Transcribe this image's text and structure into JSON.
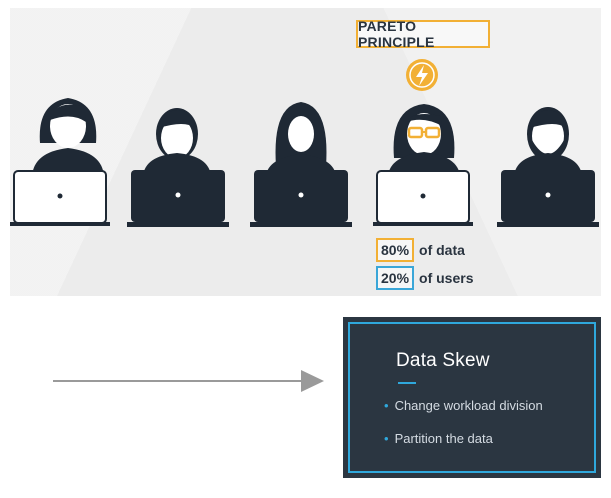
{
  "illustration": {
    "principle_label": "PARETO PRINCIPLE",
    "stats": [
      {
        "pct": "80%",
        "text": "of data",
        "color": "#f2b035"
      },
      {
        "pct": "20%",
        "text": "of users",
        "color": "#3aa6d8"
      }
    ],
    "icons": [
      "user-woman-icon",
      "user-man-icon",
      "user-hijab-icon",
      "user-woman-glasses-icon",
      "user-bearded-man-icon",
      "lightning-icon",
      "laptop-icon"
    ],
    "highlight_color": "#f2b035"
  },
  "slide": {
    "title": "Data Skew",
    "bullets": [
      "Change workload division",
      "Partition the data"
    ],
    "background": "#2b3641",
    "accent": "#2fa8dc"
  }
}
